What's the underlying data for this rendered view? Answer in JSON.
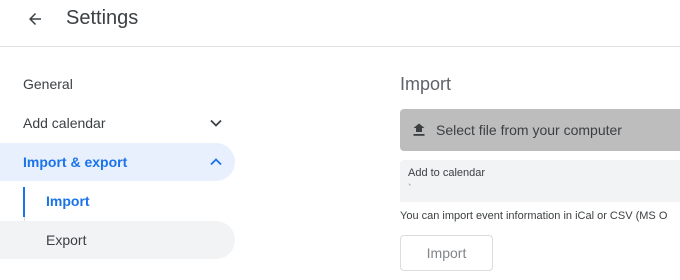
{
  "header": {
    "title": "Settings",
    "back_icon": "arrow-back-icon"
  },
  "sidebar": {
    "items": [
      {
        "label": "General"
      },
      {
        "label": "Add calendar",
        "icon": "chevron-down-icon"
      },
      {
        "label": "Import & export",
        "icon": "chevron-up-icon",
        "active": true
      }
    ],
    "subitems": [
      {
        "label": "Import",
        "selected": true
      },
      {
        "label": "Export"
      }
    ]
  },
  "main": {
    "section_title": "Import",
    "file_button": {
      "label": "Select file from your computer",
      "icon": "upload-icon"
    },
    "calendar_select": {
      "label": "Add to calendar",
      "value": "`"
    },
    "help_text": "You can import event information in iCal or CSV (MS O",
    "import_button": {
      "label": "Import"
    }
  },
  "colors": {
    "accent": "#1a73e8",
    "active_bg": "#e8f0fe",
    "file_button_bg": "#bdbdbd",
    "select_bg": "#f1f3f4"
  }
}
